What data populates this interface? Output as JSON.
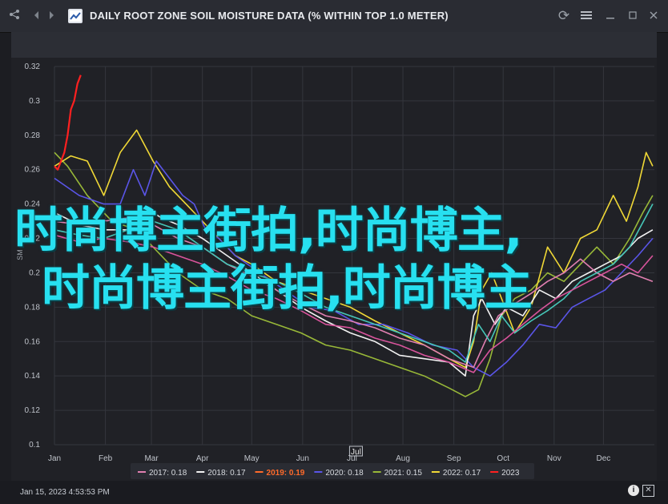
{
  "window": {
    "title": "DAILY ROOT ZONE SOIL MOISTURE DATA (% WITHIN TOP 1.0 METER)",
    "icons": [
      "share-icon",
      "back-icon",
      "forward-icon",
      "app-icon",
      "refresh-icon",
      "menu-icon",
      "minimize-icon",
      "restore-icon",
      "close-icon"
    ]
  },
  "footer": {
    "date": "Jan 15, 2023 4:53:53 PM"
  },
  "overlay": {
    "line1": "时尚博主街拍,时尚博主,",
    "line2": "时尚博主街拍,时尚博主"
  },
  "colors": {
    "2017": "#e07fb0",
    "2018": "#f2f2f2",
    "2019": "#ff6a2a",
    "2020": "#5a55e8",
    "2021": "#98b838",
    "2022": "#f0d836",
    "2023": "#ff2020",
    "teal": "#46c6b8",
    "pink": "#d9549c"
  },
  "chart_data": {
    "type": "line",
    "ylabel": "SM",
    "ylim": [
      0.1,
      0.32
    ],
    "yticks": [
      "0.32",
      "0.3",
      "0.28",
      "0.26",
      "0.24",
      "0.22",
      "0.2",
      "0.18",
      "0.16",
      "0.14",
      "0.12",
      "0.1"
    ],
    "xticks": [
      "Jan",
      "Feb",
      "Mar",
      "Apr",
      "May",
      "Jun",
      "Jul",
      "Aug",
      "Sep",
      "Oct",
      "Nov",
      "Dec"
    ],
    "x_cursor_label": "Jul",
    "legend": [
      {
        "label": "2017: 0.18",
        "key": "2017"
      },
      {
        "label": "2018: 0.17",
        "key": "2018"
      },
      {
        "label": "2019: 0.19",
        "key": "2019"
      },
      {
        "label": "2020: 0.18",
        "key": "2020"
      },
      {
        "label": "2021: 0.15",
        "key": "2021"
      },
      {
        "label": "2022: 0.17",
        "key": "2022"
      },
      {
        "label": "2023",
        "key": "2023"
      }
    ],
    "series": [
      {
        "name": "2021",
        "key": "2021",
        "points": [
          [
            0,
            0.27
          ],
          [
            8,
            0.262
          ],
          [
            20,
            0.245
          ],
          [
            35,
            0.23
          ],
          [
            50,
            0.225
          ],
          [
            60,
            0.215
          ],
          [
            75,
            0.2
          ],
          [
            90,
            0.19
          ],
          [
            105,
            0.185
          ],
          [
            120,
            0.175
          ],
          [
            135,
            0.17
          ],
          [
            150,
            0.165
          ],
          [
            165,
            0.158
          ],
          [
            180,
            0.155
          ],
          [
            195,
            0.15
          ],
          [
            210,
            0.145
          ],
          [
            225,
            0.14
          ],
          [
            240,
            0.133
          ],
          [
            250,
            0.128
          ],
          [
            258,
            0.132
          ],
          [
            265,
            0.15
          ],
          [
            272,
            0.175
          ],
          [
            280,
            0.185
          ],
          [
            290,
            0.19
          ],
          [
            300,
            0.2
          ],
          [
            310,
            0.195
          ],
          [
            320,
            0.205
          ],
          [
            330,
            0.215
          ],
          [
            340,
            0.205
          ],
          [
            350,
            0.22
          ],
          [
            358,
            0.235
          ],
          [
            364,
            0.245
          ]
        ]
      },
      {
        "name": "2022",
        "key": "2022",
        "points": [
          [
            0,
            0.262
          ],
          [
            10,
            0.268
          ],
          [
            20,
            0.265
          ],
          [
            30,
            0.245
          ],
          [
            40,
            0.27
          ],
          [
            50,
            0.283
          ],
          [
            60,
            0.265
          ],
          [
            70,
            0.25
          ],
          [
            80,
            0.24
          ],
          [
            90,
            0.23
          ],
          [
            100,
            0.22
          ],
          [
            110,
            0.21
          ],
          [
            120,
            0.205
          ],
          [
            135,
            0.195
          ],
          [
            150,
            0.19
          ],
          [
            165,
            0.185
          ],
          [
            180,
            0.18
          ],
          [
            195,
            0.172
          ],
          [
            210,
            0.165
          ],
          [
            225,
            0.158
          ],
          [
            240,
            0.15
          ],
          [
            250,
            0.145
          ],
          [
            255,
            0.16
          ],
          [
            260,
            0.19
          ],
          [
            266,
            0.2
          ],
          [
            272,
            0.185
          ],
          [
            280,
            0.165
          ],
          [
            290,
            0.18
          ],
          [
            300,
            0.215
          ],
          [
            310,
            0.2
          ],
          [
            320,
            0.22
          ],
          [
            330,
            0.225
          ],
          [
            340,
            0.245
          ],
          [
            348,
            0.23
          ],
          [
            355,
            0.25
          ],
          [
            360,
            0.27
          ],
          [
            364,
            0.262
          ]
        ]
      },
      {
        "name": "2020",
        "key": "2020",
        "points": [
          [
            0,
            0.255
          ],
          [
            15,
            0.245
          ],
          [
            30,
            0.24
          ],
          [
            40,
            0.24
          ],
          [
            48,
            0.26
          ],
          [
            55,
            0.245
          ],
          [
            62,
            0.265
          ],
          [
            70,
            0.255
          ],
          [
            78,
            0.245
          ],
          [
            85,
            0.24
          ],
          [
            92,
            0.225
          ],
          [
            100,
            0.22
          ],
          [
            110,
            0.21
          ],
          [
            125,
            0.2
          ],
          [
            140,
            0.19
          ],
          [
            155,
            0.18
          ],
          [
            170,
            0.178
          ],
          [
            185,
            0.17
          ],
          [
            200,
            0.17
          ],
          [
            215,
            0.165
          ],
          [
            230,
            0.158
          ],
          [
            245,
            0.155
          ],
          [
            255,
            0.145
          ],
          [
            265,
            0.14
          ],
          [
            275,
            0.148
          ],
          [
            285,
            0.158
          ],
          [
            295,
            0.17
          ],
          [
            305,
            0.168
          ],
          [
            315,
            0.18
          ],
          [
            325,
            0.185
          ],
          [
            335,
            0.19
          ],
          [
            345,
            0.2
          ],
          [
            355,
            0.21
          ],
          [
            364,
            0.22
          ]
        ]
      },
      {
        "name": "2018",
        "key": "2018",
        "points": [
          [
            0,
            0.235
          ],
          [
            15,
            0.228
          ],
          [
            30,
            0.225
          ],
          [
            45,
            0.225
          ],
          [
            55,
            0.238
          ],
          [
            65,
            0.232
          ],
          [
            75,
            0.228
          ],
          [
            90,
            0.22
          ],
          [
            105,
            0.21
          ],
          [
            120,
            0.2
          ],
          [
            135,
            0.19
          ],
          [
            150,
            0.18
          ],
          [
            165,
            0.172
          ],
          [
            180,
            0.165
          ],
          [
            195,
            0.16
          ],
          [
            210,
            0.152
          ],
          [
            225,
            0.15
          ],
          [
            240,
            0.148
          ],
          [
            250,
            0.14
          ],
          [
            255,
            0.175
          ],
          [
            260,
            0.185
          ],
          [
            268,
            0.17
          ],
          [
            275,
            0.18
          ],
          [
            285,
            0.175
          ],
          [
            295,
            0.19
          ],
          [
            305,
            0.185
          ],
          [
            315,
            0.195
          ],
          [
            325,
            0.2
          ],
          [
            335,
            0.205
          ],
          [
            345,
            0.21
          ],
          [
            355,
            0.22
          ],
          [
            364,
            0.225
          ]
        ]
      },
      {
        "name": "2017",
        "key": "2017",
        "points": [
          [
            0,
            0.23
          ],
          [
            15,
            0.228
          ],
          [
            30,
            0.23
          ],
          [
            45,
            0.232
          ],
          [
            60,
            0.228
          ],
          [
            75,
            0.22
          ],
          [
            90,
            0.215
          ],
          [
            105,
            0.205
          ],
          [
            120,
            0.198
          ],
          [
            135,
            0.19
          ],
          [
            150,
            0.182
          ],
          [
            165,
            0.175
          ],
          [
            180,
            0.172
          ],
          [
            195,
            0.168
          ],
          [
            210,
            0.162
          ],
          [
            225,
            0.158
          ],
          [
            240,
            0.15
          ],
          [
            255,
            0.145
          ],
          [
            262,
            0.16
          ],
          [
            270,
            0.175
          ],
          [
            280,
            0.182
          ],
          [
            290,
            0.188
          ],
          [
            300,
            0.195
          ],
          [
            310,
            0.2
          ],
          [
            320,
            0.208
          ],
          [
            330,
            0.2
          ],
          [
            340,
            0.195
          ],
          [
            350,
            0.2
          ],
          [
            364,
            0.195
          ]
        ]
      },
      {
        "name": "teal",
        "key": "teal",
        "points": [
          [
            0,
            0.225
          ],
          [
            15,
            0.222
          ],
          [
            30,
            0.22
          ],
          [
            45,
            0.225
          ],
          [
            60,
            0.23
          ],
          [
            75,
            0.225
          ],
          [
            90,
            0.215
          ],
          [
            105,
            0.205
          ],
          [
            120,
            0.2
          ],
          [
            135,
            0.195
          ],
          [
            150,
            0.188
          ],
          [
            165,
            0.18
          ],
          [
            180,
            0.175
          ],
          [
            195,
            0.17
          ],
          [
            210,
            0.165
          ],
          [
            225,
            0.16
          ],
          [
            240,
            0.155
          ],
          [
            250,
            0.148
          ],
          [
            258,
            0.17
          ],
          [
            265,
            0.16
          ],
          [
            272,
            0.175
          ],
          [
            280,
            0.165
          ],
          [
            290,
            0.172
          ],
          [
            300,
            0.178
          ],
          [
            310,
            0.185
          ],
          [
            320,
            0.195
          ],
          [
            330,
            0.2
          ],
          [
            340,
            0.205
          ],
          [
            350,
            0.215
          ],
          [
            364,
            0.24
          ]
        ]
      },
      {
        "name": "pink",
        "key": "pink",
        "points": [
          [
            0,
            0.222
          ],
          [
            15,
            0.218
          ],
          [
            30,
            0.22
          ],
          [
            45,
            0.218
          ],
          [
            60,
            0.215
          ],
          [
            75,
            0.21
          ],
          [
            90,
            0.205
          ],
          [
            105,
            0.198
          ],
          [
            120,
            0.19
          ],
          [
            135,
            0.185
          ],
          [
            150,
            0.178
          ],
          [
            165,
            0.17
          ],
          [
            180,
            0.168
          ],
          [
            195,
            0.162
          ],
          [
            210,
            0.158
          ],
          [
            225,
            0.152
          ],
          [
            240,
            0.148
          ],
          [
            255,
            0.142
          ],
          [
            265,
            0.155
          ],
          [
            275,
            0.162
          ],
          [
            285,
            0.17
          ],
          [
            295,
            0.178
          ],
          [
            305,
            0.185
          ],
          [
            315,
            0.19
          ],
          [
            325,
            0.195
          ],
          [
            335,
            0.2
          ],
          [
            345,
            0.205
          ],
          [
            355,
            0.2
          ],
          [
            364,
            0.21
          ]
        ]
      },
      {
        "name": "2023",
        "key": "2023",
        "points": [
          [
            0,
            0.262
          ],
          [
            2,
            0.26
          ],
          [
            4,
            0.265
          ],
          [
            6,
            0.27
          ],
          [
            8,
            0.28
          ],
          [
            10,
            0.295
          ],
          [
            12,
            0.3
          ],
          [
            14,
            0.31
          ],
          [
            16,
            0.315
          ]
        ]
      }
    ]
  }
}
